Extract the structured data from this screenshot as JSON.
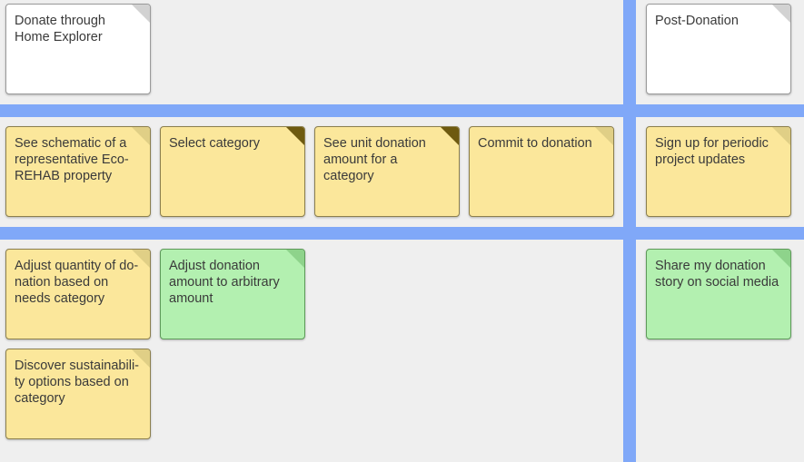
{
  "colors": {
    "board_background": "#efefef",
    "divider": "#80a8f8",
    "white_card": "#ffffff",
    "yellow_card": "#fbe79b",
    "green_card": "#b3f0b0"
  },
  "row1": {
    "donate_home_explorer": "Donate through Home Explorer",
    "post_donation": "Post-Donation"
  },
  "row2": {
    "see_schematic": "See schematic of a representative Eco-REHAB property",
    "select_category": "Select category",
    "see_unit_amount": "See unit donation amount for a category",
    "commit_donation": "Commit to donation",
    "sign_up_updates": "Sign up for periodic project updates"
  },
  "row3": {
    "adjust_quantity": "Adjust quantity of do-nation based on needs category",
    "adjust_arbitrary": "Adjust donation amount to arbitrary amount",
    "share_story": "Share my donation story on social media",
    "discover_sustainability": "Discover sustainabili-ty options based on category"
  }
}
